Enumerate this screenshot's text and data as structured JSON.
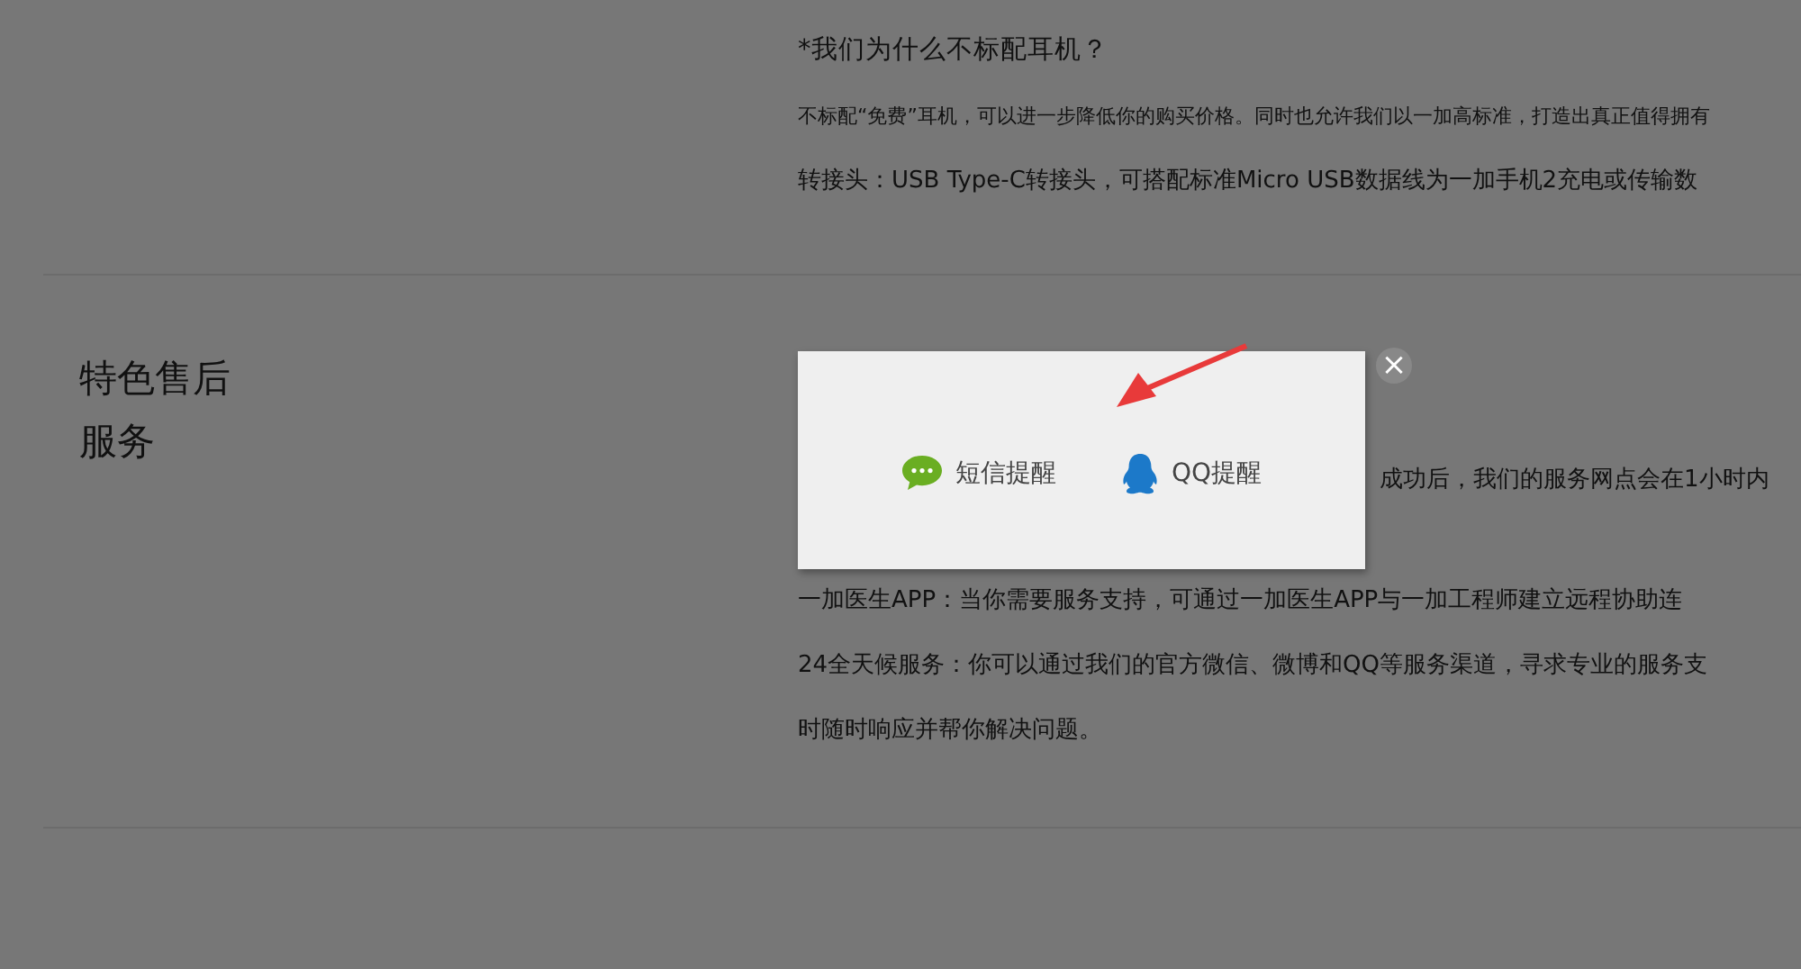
{
  "sections": [
    {
      "paragraphs": [
        {
          "kind": "title",
          "text": "*我们为什么不标配耳机？"
        },
        {
          "kind": "small",
          "text": "不标配“免费”耳机，可以进一步降低你的购买价格。同时也允许我们以一加高标准，打造出真正值得拥有"
        },
        {
          "kind": "body",
          "text": "转接头：USB Type-C转接头，可搭配标准Micro USB数据线为一加手机2充电或传输数"
        }
      ]
    },
    {
      "heading_lines": [
        "特色售后",
        "服务"
      ],
      "paragraphs": [
        {
          "kind": "tail",
          "text": "成功后，我们的服务网点会在1小时内"
        },
        {
          "kind": "body",
          "text": "一加医生APP：当你需要服务支持，可通过一加医生APP与一加工程师建立远程协助连"
        },
        {
          "kind": "body",
          "text": "24全天候服务：你可以通过我们的官方微信、微博和QQ等服务渠道，寻求专业的服务支"
        },
        {
          "kind": "body",
          "text": "时随时响应并帮你解决问题。"
        }
      ]
    }
  ],
  "dialog": {
    "close": "×",
    "options": [
      {
        "kind": "sms",
        "label": "短信提醒"
      },
      {
        "kind": "qq",
        "label": "QQ提醒"
      }
    ]
  }
}
